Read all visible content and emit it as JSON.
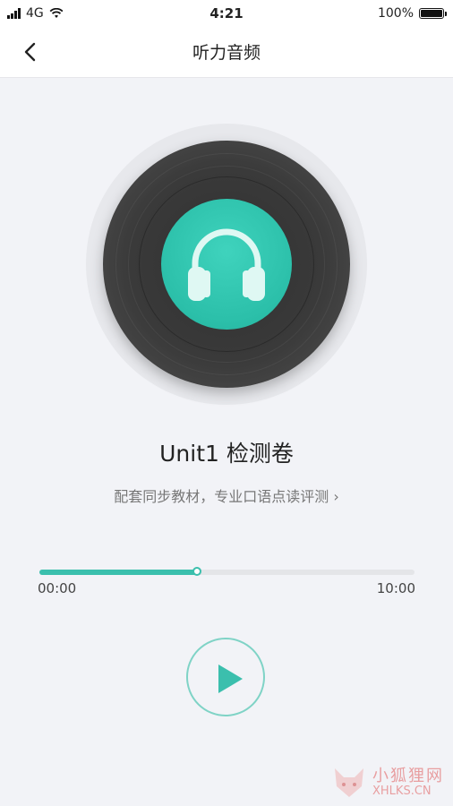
{
  "status_bar": {
    "network": "4G",
    "time": "4:21",
    "battery": "100%"
  },
  "nav": {
    "title": "听力音频",
    "back_icon": "chevron-left-icon"
  },
  "player": {
    "track_title": "Unit1 检测卷",
    "subtitle": "配套同步教材，专业口语点读评测 ›",
    "current_time": "00:00",
    "total_time": "10:00",
    "progress": 0.42,
    "accent_color": "#3bbfad",
    "play_icon": "play-icon"
  },
  "watermark": {
    "cn": "小狐狸网",
    "en": "XHLKS.CN"
  }
}
